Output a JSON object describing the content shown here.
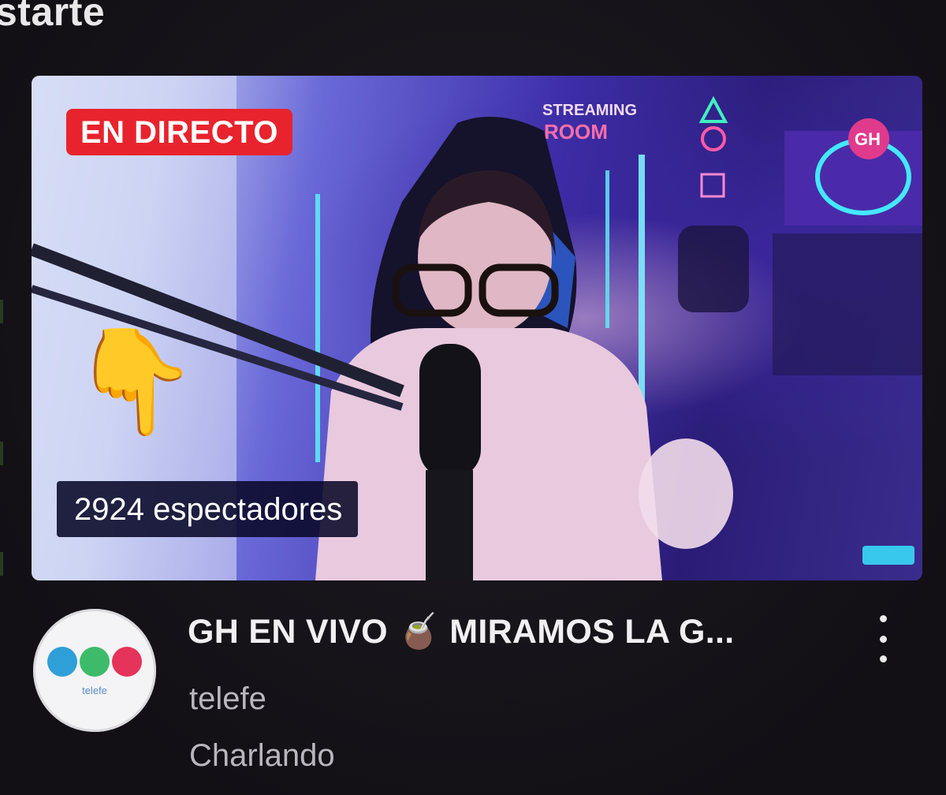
{
  "section": {
    "title": "starte"
  },
  "stream": {
    "live_label": "EN DIRECTO",
    "viewers": "2924 espectadores",
    "pointer_emoji": "👇",
    "title": "GH EN VIVO 🧉 MIRAMOS LA G...",
    "channel": "telefe",
    "category": "Charlando"
  },
  "colors": {
    "live_badge": "#e8232d",
    "telefe_dots": [
      "#2f9fd8",
      "#3dbb6a",
      "#e6335a"
    ]
  },
  "icons": {
    "menu": "more-vert-icon",
    "avatar": "telefe-logo"
  }
}
